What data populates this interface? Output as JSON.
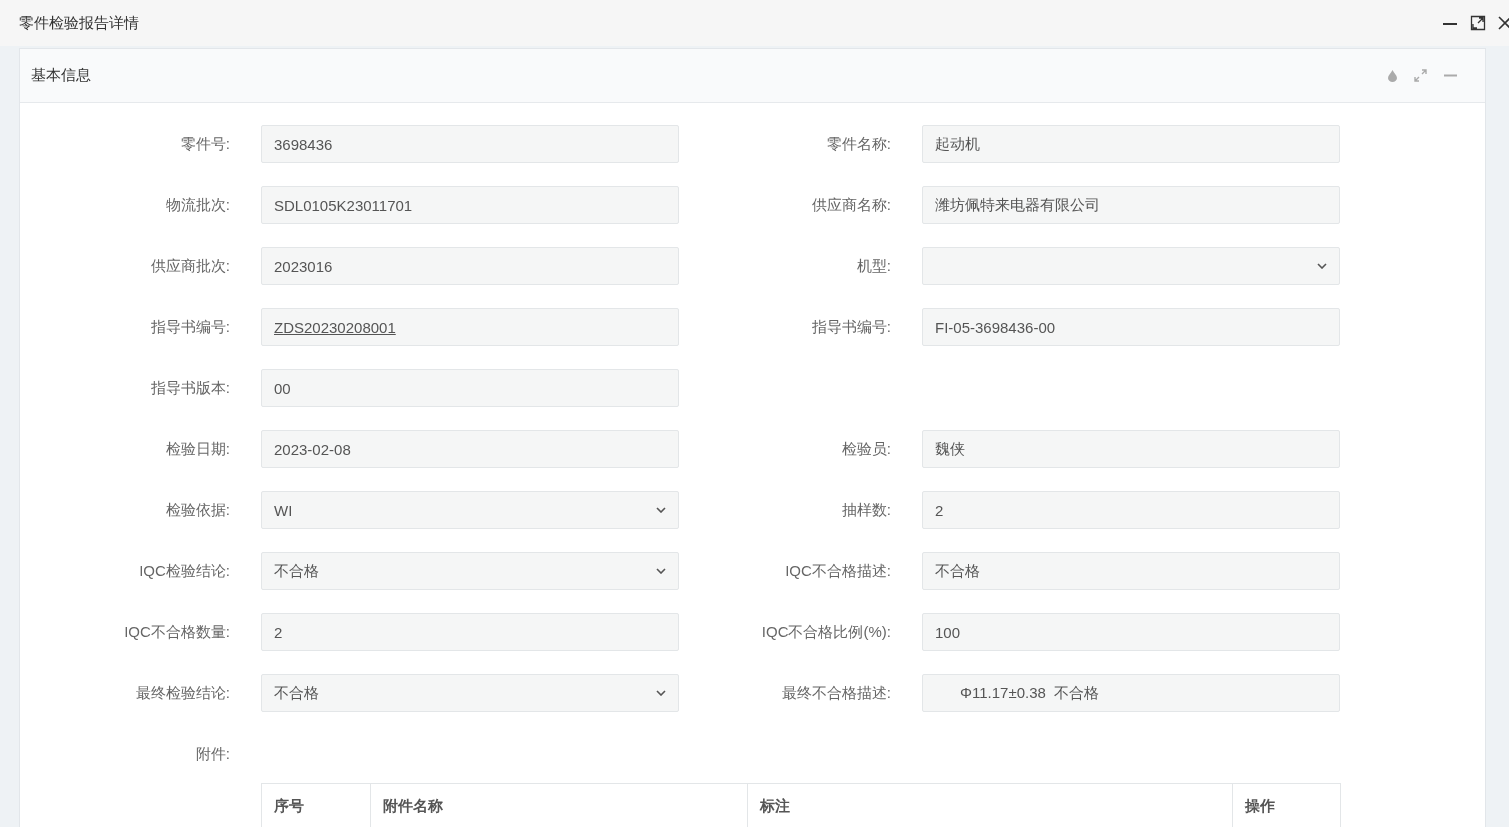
{
  "window": {
    "title": "零件检验报告详情"
  },
  "panel": {
    "title": "基本信息"
  },
  "rows": [
    {
      "left": {
        "label": "零件号:",
        "kind": "input",
        "value": "3698436"
      },
      "right": {
        "label": "零件名称:",
        "kind": "input",
        "value": "起动机"
      }
    },
    {
      "left": {
        "label": "物流批次:",
        "kind": "input",
        "value": "SDL0105K23011701"
      },
      "right": {
        "label": "供应商名称:",
        "kind": "input",
        "value": "潍坊佩特来电器有限公司"
      }
    },
    {
      "left": {
        "label": "供应商批次:",
        "kind": "input",
        "value": "2023016"
      },
      "right": {
        "label": "机型:",
        "kind": "select"
      }
    },
    {
      "left": {
        "label": "指导书编号:",
        "kind": "link",
        "value": "ZDS20230208001"
      },
      "right": {
        "label": "指导书编号:",
        "kind": "input",
        "value": "FI-05-3698436-00"
      }
    },
    {
      "left": {
        "label": "指导书版本:",
        "kind": "input",
        "value": "00"
      }
    },
    {
      "left": {
        "label": "检验日期:",
        "kind": "input",
        "value": "2023-02-08"
      },
      "right": {
        "label": "检验员:",
        "kind": "input",
        "value": "魏侠"
      }
    },
    {
      "left": {
        "label": "检验依据:",
        "kind": "select",
        "value": "WI"
      },
      "right": {
        "label": "抽样数:",
        "kind": "input",
        "value": "2"
      }
    },
    {
      "left": {
        "label": "IQC检验结论:",
        "kind": "select",
        "value": "不合格"
      },
      "right": {
        "label": "IQC不合格描述:",
        "kind": "input",
        "value": "不合格"
      }
    },
    {
      "left": {
        "label": "IQC不合格数量:",
        "kind": "input",
        "value": "2"
      },
      "right": {
        "label": "IQC不合格比例(%):",
        "kind": "input",
        "value": "100"
      }
    },
    {
      "left": {
        "label": "最终检验结论:",
        "kind": "select",
        "value": "不合格"
      },
      "right": {
        "label": "最终不合格描述:",
        "kind": "input",
        "value": "      Φ11.17±0.38  不合格"
      }
    }
  ],
  "attachments": {
    "label": "附件:",
    "columns": [
      "序号",
      "附件名称",
      "标注",
      "操作"
    ]
  }
}
